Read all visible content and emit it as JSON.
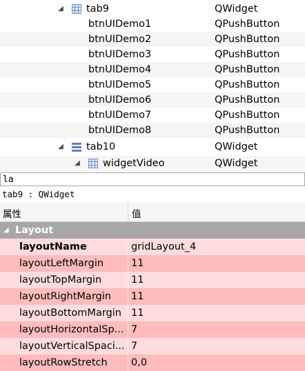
{
  "tree": {
    "rows": [
      {
        "name": "tab9",
        "class": "QWidget",
        "arrow": "◢",
        "icon": "grid-icon"
      },
      {
        "name": "btnUIDemo1",
        "class": "QPushButton"
      },
      {
        "name": "btnUIDemo2",
        "class": "QPushButton"
      },
      {
        "name": "btnUIDemo3",
        "class": "QPushButton"
      },
      {
        "name": "btnUIDemo4",
        "class": "QPushButton"
      },
      {
        "name": "btnUIDemo5",
        "class": "QPushButton"
      },
      {
        "name": "btnUIDemo6",
        "class": "QPushButton"
      },
      {
        "name": "btnUIDemo7",
        "class": "QPushButton"
      },
      {
        "name": "btnUIDemo8",
        "class": "QPushButton"
      },
      {
        "name": "tab10",
        "class": "QWidget",
        "arrow": "◢",
        "icon": "stacked-layout-icon"
      },
      {
        "name": "widgetVideo",
        "class": "QWidget",
        "arrow": "◢",
        "icon": "grid-icon"
      }
    ]
  },
  "filter": {
    "value": "la"
  },
  "object_label": "tab9 : QWidget",
  "property_header": {
    "property": "属性",
    "value": "值"
  },
  "group": {
    "name": "Layout",
    "arrow": "◢"
  },
  "properties": [
    {
      "name": "layoutName",
      "value": "gridLayout_4"
    },
    {
      "name": "layoutLeftMargin",
      "value": "11"
    },
    {
      "name": "layoutTopMargin",
      "value": "11"
    },
    {
      "name": "layoutRightMargin",
      "value": "11"
    },
    {
      "name": "layoutBottomMargin",
      "value": "11"
    },
    {
      "name": "layoutHorizontalSp...",
      "value": "7"
    },
    {
      "name": "layoutVerticalSpaci...",
      "value": "7"
    },
    {
      "name": "layoutRowStretch",
      "value": "0,0"
    }
  ],
  "colors": {
    "group_bg": "#a7a7a7",
    "row_light": "#ffdcdc",
    "row_dark": "#ffbcbc",
    "tree_alt": "#f5f5f5"
  }
}
